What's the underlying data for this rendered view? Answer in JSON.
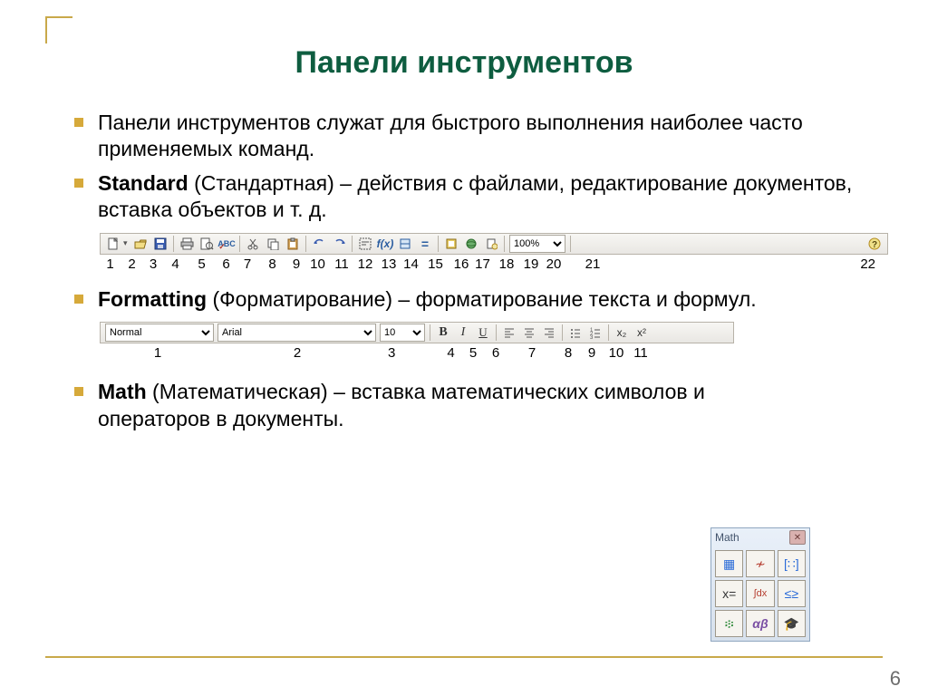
{
  "title": "Панели инструментов",
  "page_number": "6",
  "bullets": {
    "b1": "Панели инструментов служат для быстрого выполнения наиболее часто применяемых команд.",
    "b2_bold": "Standard",
    "b2_rest": " (Стандартная)  – действия с файлами, редактирование документов, вставка объектов и т. д.",
    "b3_bold": "Formatting",
    "b3_rest": " (Форматирование)  – форматирование текста и формул.",
    "b4_bold": "Math",
    "b4_rest": " (Математическая)  – вставка математических символов и операторов в документы."
  },
  "standard": {
    "zoom": "100%",
    "fx_label": "f(x)",
    "labels": [
      "1",
      "2",
      "3",
      "4",
      "5",
      "6",
      "7",
      "8",
      "9",
      "10",
      "11",
      "12",
      "13",
      "14",
      "15",
      "16",
      "17",
      "18",
      "19",
      "20",
      "21",
      "22"
    ]
  },
  "formatting": {
    "style": "Normal",
    "font": "Arial",
    "size": "10",
    "b": "B",
    "i": "I",
    "u": "U",
    "x2": "x₂",
    "x2sup": "x²",
    "labels": [
      "1",
      "2",
      "3",
      "4",
      "5",
      "6",
      "7",
      "8",
      "9",
      "10",
      "11"
    ]
  },
  "math_palette": {
    "title": "Math",
    "cells": {
      "c1": "▦",
      "c2": "≁",
      "c3": "[∷]",
      "c4": "x=",
      "c5": "∫dx",
      "c6": "≤≥",
      "c7": "፨",
      "c8": "αβ",
      "c9": "🎓"
    }
  }
}
